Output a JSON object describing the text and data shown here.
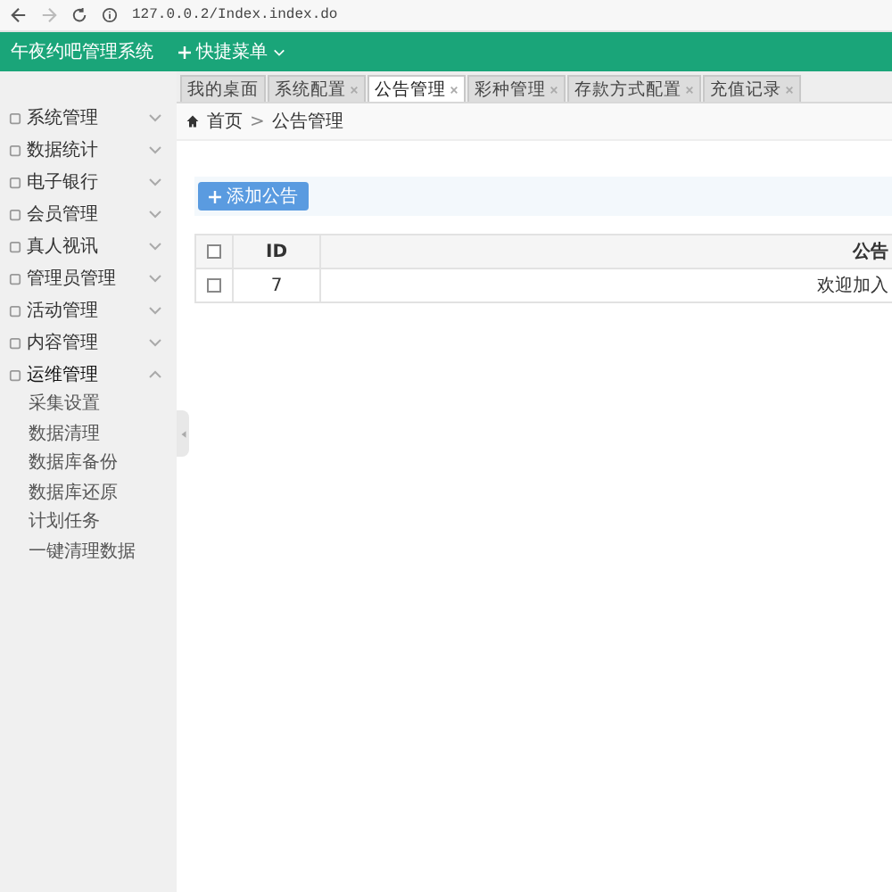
{
  "browser": {
    "url": "127.0.0.2/Index.index.do"
  },
  "header": {
    "title": "午夜约吧管理系统",
    "quick_menu": "快捷菜单"
  },
  "tabs": [
    {
      "label": "我的桌面",
      "selected": false,
      "closable": false
    },
    {
      "label": "系统配置",
      "selected": false,
      "closable": true
    },
    {
      "label": "公告管理",
      "selected": true,
      "closable": true
    },
    {
      "label": "彩种管理",
      "selected": false,
      "closable": true
    },
    {
      "label": "存款方式配置",
      "selected": false,
      "closable": true
    },
    {
      "label": "充值记录",
      "selected": false,
      "closable": true
    }
  ],
  "sidebar": {
    "items": [
      {
        "label": "系统管理",
        "expanded": false
      },
      {
        "label": "数据统计",
        "expanded": false
      },
      {
        "label": "电子银行",
        "expanded": false
      },
      {
        "label": "会员管理",
        "expanded": false
      },
      {
        "label": "真人视讯",
        "expanded": false
      },
      {
        "label": "管理员管理",
        "expanded": false
      },
      {
        "label": "活动管理",
        "expanded": false
      },
      {
        "label": "内容管理",
        "expanded": false
      },
      {
        "label": "运维管理",
        "expanded": true,
        "children": [
          {
            "label": "采集设置"
          },
          {
            "label": "数据清理"
          },
          {
            "label": "数据库备份"
          },
          {
            "label": "数据库还原"
          },
          {
            "label": "计划任务"
          },
          {
            "label": "一键清理数据"
          }
        ]
      }
    ]
  },
  "breadcrumb": {
    "home": "首页",
    "separator": ">",
    "current": "公告管理"
  },
  "add_button": "添加公告",
  "table": {
    "columns": [
      "ID",
      "公告"
    ],
    "rows": [
      {
        "checked": false,
        "cells": [
          "7",
          "欢迎加入"
        ]
      }
    ],
    "header_checked": false
  }
}
